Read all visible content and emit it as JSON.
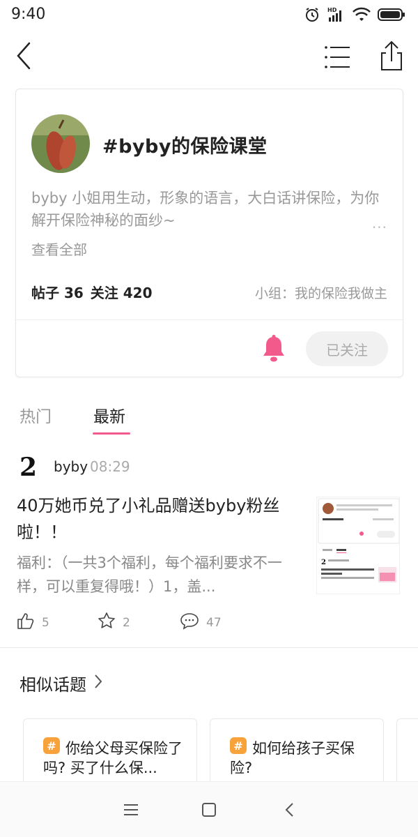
{
  "status_bar": {
    "time": "9:40",
    "icons": [
      "alarm-icon",
      "hd-signal-icon",
      "wifi-icon",
      "battery-icon"
    ]
  },
  "nav": {
    "icons": [
      "back-arrow-icon",
      "list-menu-icon",
      "share-icon"
    ]
  },
  "topic": {
    "title": "#byby的保险课堂",
    "description": "byby 小姐用生动，形象的语言，大白话讲保险，为你解开保险神秘的面纱~",
    "more_dots": "···",
    "view_all": "查看全部",
    "posts_label": "帖子 36",
    "follows_label": "关注 420",
    "group": "小组：我的保险我做主",
    "follow_button": "已关注",
    "accent_color": "#f25a8c"
  },
  "tabs": [
    {
      "label": "热门",
      "active": false
    },
    {
      "label": "最新",
      "active": true
    }
  ],
  "post": {
    "author": "byby",
    "time": "08:29",
    "title": "40万她币兑了小礼品赠送byby粉丝啦！！",
    "excerpt": "福利：（一共3个福利，每个福利要求不一样，可以重复得哦！）1，盖...",
    "likes": "5",
    "favorites": "2",
    "comments": "47"
  },
  "similar": {
    "heading": "相似话题",
    "hash_symbol": "#",
    "items": [
      {
        "title": "你给父母买保险了吗? 买了什么保..."
      },
      {
        "title": "如何给孩子买保险?"
      }
    ]
  },
  "bottom_nav": {
    "icons": [
      "menu-icon",
      "home-icon",
      "back-icon"
    ]
  }
}
